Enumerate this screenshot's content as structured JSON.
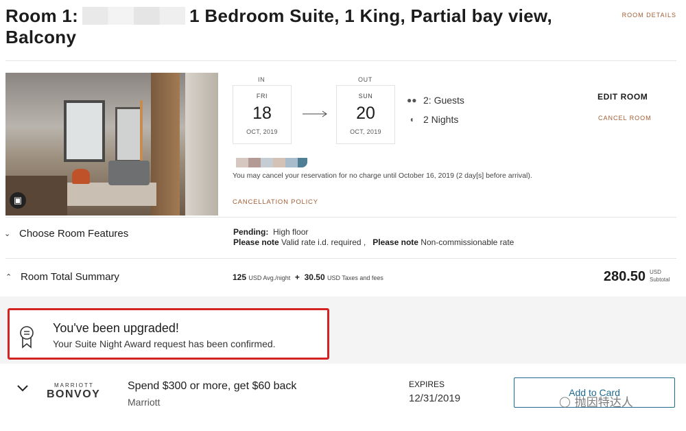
{
  "room": {
    "title_prefix": "Room  1:",
    "title_rest": "1 Bedroom Suite, 1 King, Partial bay view,",
    "title_line2": "Balcony",
    "details_link": "ROOM DETAILS"
  },
  "dates": {
    "in_label": "IN",
    "out_label": "OUT",
    "checkin": {
      "dow": "FRI",
      "day": "18",
      "month": "OCT, 2019"
    },
    "checkout": {
      "dow": "SUN",
      "day": "20",
      "month": "OCT, 2019"
    }
  },
  "stay": {
    "guests": "2: Guests",
    "nights": "2 Nights",
    "guests_icon": "guests-icon",
    "nights_icon": "moon-icon"
  },
  "actions": {
    "edit_room": "EDIT ROOM",
    "cancel_room": "CANCEL ROOM"
  },
  "cancellation": {
    "text": "You may cancel your reservation for no charge until October 16, 2019 (2 day[s] before arrival).",
    "policy_link": "CANCELLATION POLICY"
  },
  "features": {
    "toggle_label": "Choose Room Features",
    "pending_label": "Pending:",
    "pending_value": "High floor",
    "note_label_1": "Please note",
    "note_value_1": "Valid rate i.d. required ,",
    "note_label_2": "Please note",
    "note_value_2": "Non-commissionable rate"
  },
  "summary": {
    "toggle_label": "Room Total Summary",
    "avg_night": "125",
    "avg_night_unit": "USD Avg./night",
    "plus": "+",
    "taxes": "30.50",
    "taxes_unit": "USD Taxes and fees",
    "total": "280.50",
    "total_currency": "USD",
    "total_label": "Subtotal"
  },
  "upgrade": {
    "title": "You've been upgraded!",
    "subtitle": "Your Suite Night Award request has been confirmed."
  },
  "offer": {
    "brand_top": "MARRIOTT",
    "brand_main": "BONVOY",
    "brand_sub": "Bonvoy",
    "title": "Spend $300 or more, get $60 back",
    "merchant": "Marriott",
    "expires_label": "EXPIRES",
    "expires_date": "12/31/2019",
    "button_label": "Add to Card"
  },
  "watermark": {
    "text": "抛因特达人"
  },
  "colors": {
    "accent_link": "#a15d33",
    "highlight_border": "#d42222",
    "button_blue": "#1c6a8f"
  }
}
